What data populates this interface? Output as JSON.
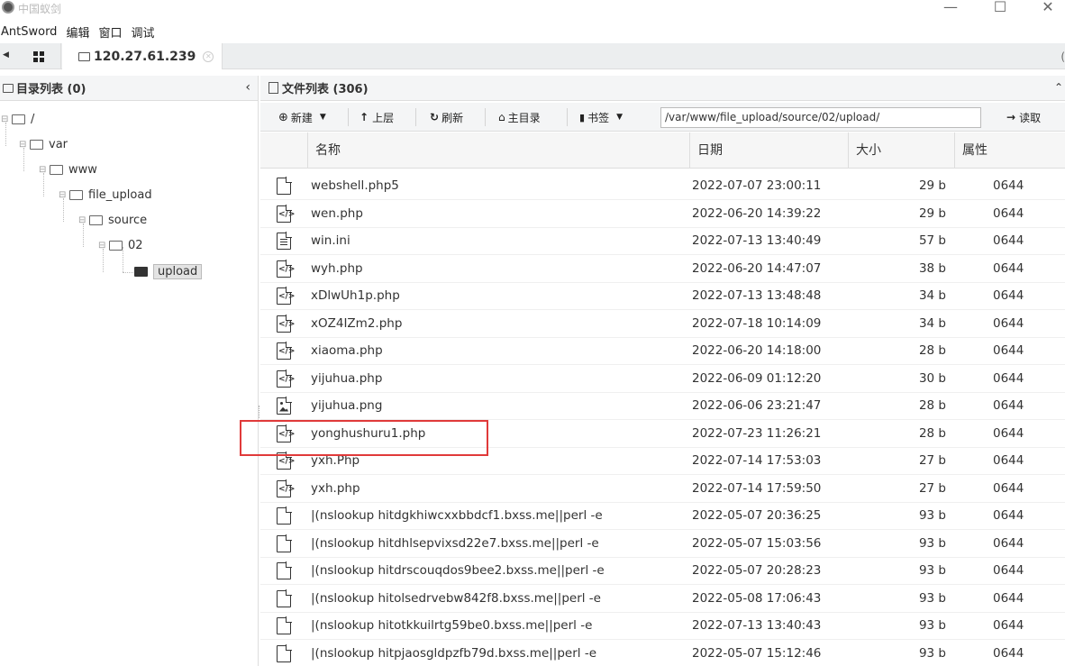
{
  "window": {
    "title": "中国蚁剑",
    "minimize": "—",
    "maximize": "☐",
    "close": "✕"
  },
  "menu": [
    "AntSword",
    "编辑",
    "窗口",
    "调试"
  ],
  "tabs": {
    "ip": "120.27.61.239"
  },
  "left_panel": {
    "header": "目录列表 (0)",
    "tree": [
      {
        "label": "/",
        "depth": 0
      },
      {
        "label": "var",
        "depth": 1
      },
      {
        "label": "www",
        "depth": 2
      },
      {
        "label": "file_upload",
        "depth": 3
      },
      {
        "label": "source",
        "depth": 4
      },
      {
        "label": "02",
        "depth": 5
      },
      {
        "label": "upload",
        "depth": 6,
        "selected": true
      }
    ]
  },
  "right_panel": {
    "header": "文件列表 (306)",
    "toolbar": {
      "new": "新建",
      "up": "上层",
      "refresh": "刷新",
      "home": "主目录",
      "bookmark": "书签",
      "path": "/var/www/file_upload/source/02/upload/",
      "read": "读取"
    },
    "columns": [
      "名称",
      "日期",
      "大小",
      "属性"
    ],
    "rows": [
      {
        "name": "webshell.php5",
        "date": "2022-07-07 23:00:11",
        "size": "29 b",
        "perm": "0644",
        "icon": "file"
      },
      {
        "name": "wen.php",
        "date": "2022-06-20 14:39:22",
        "size": "29 b",
        "perm": "0644",
        "icon": "code"
      },
      {
        "name": "win.ini",
        "date": "2022-07-13 13:40:49",
        "size": "57 b",
        "perm": "0644",
        "icon": "text"
      },
      {
        "name": "wyh.php",
        "date": "2022-06-20 14:47:07",
        "size": "38 b",
        "perm": "0644",
        "icon": "code"
      },
      {
        "name": "xDlwUh1p.php",
        "date": "2022-07-13 13:48:48",
        "size": "34 b",
        "perm": "0644",
        "icon": "code"
      },
      {
        "name": "xOZ4IZm2.php",
        "date": "2022-07-18 10:14:09",
        "size": "34 b",
        "perm": "0644",
        "icon": "code"
      },
      {
        "name": "xiaoma.php",
        "date": "2022-06-20 14:18:00",
        "size": "28 b",
        "perm": "0644",
        "icon": "code"
      },
      {
        "name": "yijuhua.php",
        "date": "2022-06-09 01:12:20",
        "size": "30 b",
        "perm": "0644",
        "icon": "code"
      },
      {
        "name": "yijuhua.png",
        "date": "2022-06-06 23:21:47",
        "size": "28 b",
        "perm": "0644",
        "icon": "image"
      },
      {
        "name": "yonghushuru1.php",
        "date": "2022-07-23 11:26:21",
        "size": "28 b",
        "perm": "0644",
        "icon": "code"
      },
      {
        "name": "yxh.Php",
        "date": "2022-07-14 17:53:03",
        "size": "27 b",
        "perm": "0644",
        "icon": "code"
      },
      {
        "name": "yxh.php",
        "date": "2022-07-14 17:59:50",
        "size": "27 b",
        "perm": "0644",
        "icon": "code"
      },
      {
        "name": "|(nslookup hitdgkhiwcxxbbdcf1.bxss.me||perl -e",
        "date": "2022-05-07 20:36:25",
        "size": "93 b",
        "perm": "0644",
        "icon": "file"
      },
      {
        "name": "|(nslookup hitdhlsepvixsd22e7.bxss.me||perl -e",
        "date": "2022-05-07 15:03:56",
        "size": "93 b",
        "perm": "0644",
        "icon": "file"
      },
      {
        "name": "|(nslookup hitdrscouqdos9bee2.bxss.me||perl -e",
        "date": "2022-05-07 20:28:23",
        "size": "93 b",
        "perm": "0644",
        "icon": "file"
      },
      {
        "name": "|(nslookup hitolsedrvebw842f8.bxss.me||perl -e",
        "date": "2022-05-08 17:06:43",
        "size": "93 b",
        "perm": "0644",
        "icon": "file"
      },
      {
        "name": "|(nslookup hitotkkuilrtg59be0.bxss.me||perl -e",
        "date": "2022-07-13 13:40:43",
        "size": "93 b",
        "perm": "0644",
        "icon": "file"
      },
      {
        "name": "|(nslookup hitpjaosgldpzfb79d.bxss.me||perl -e",
        "date": "2022-05-07 15:12:46",
        "size": "93 b",
        "perm": "0644",
        "icon": "file"
      }
    ]
  },
  "colors": {
    "highlight": "#e03a3a",
    "header_bg": "#f4f5f6"
  }
}
